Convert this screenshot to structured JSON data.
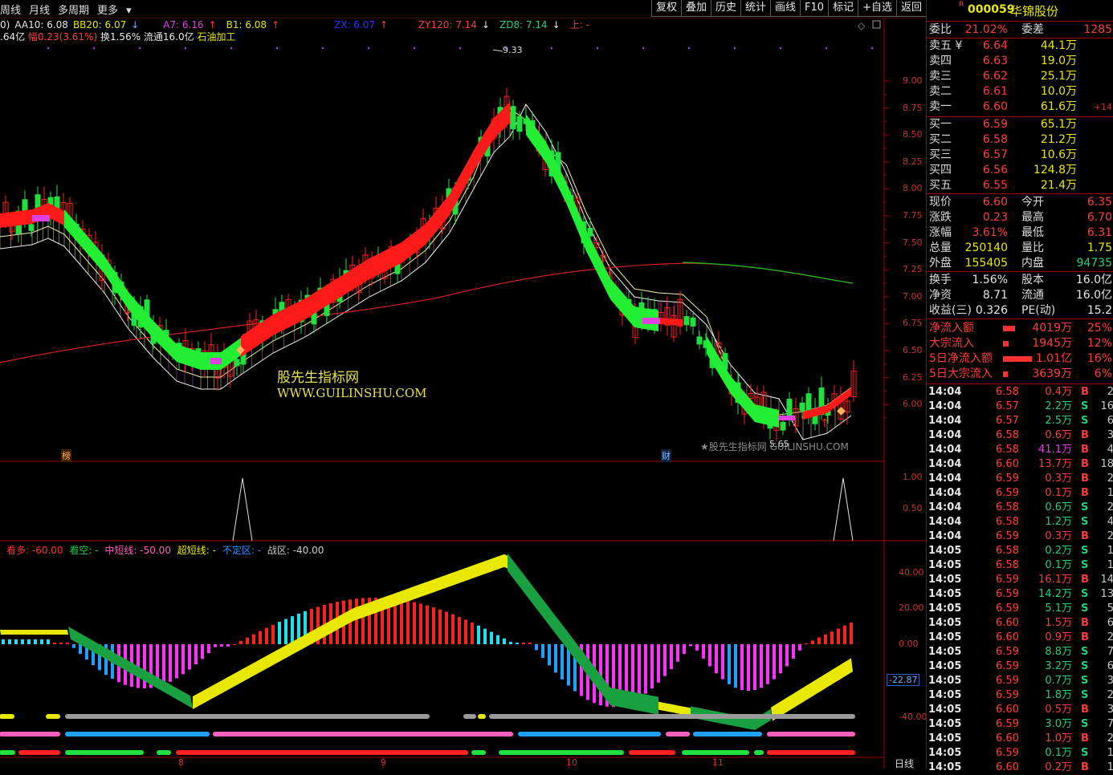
{
  "toolbar": {
    "left": [
      "周线",
      "月线",
      "多周期",
      "更多"
    ],
    "right": [
      "复权",
      "叠加",
      "历史",
      "统计",
      "画线",
      "F10",
      "标记",
      "+自选",
      "返回"
    ]
  },
  "indicators": {
    "p0": "0)",
    "aa10": "AA10: 6.08",
    "bb20": "BB20: 6.07",
    "a7": "A7: 6.16",
    "b1": "B1: 6.08",
    "zx": "ZX: 6.07",
    "zy120": "ZY120: 7.14",
    "zd8": "ZD8: 7.14",
    "up": "上: -"
  },
  "info": {
    "amount": ".64亿",
    "change": "幅0.23(3.61%)",
    "turnover": "换1.56%",
    "float": "流通16.0亿",
    "industry": "石油加工"
  },
  "price_axis": [
    "9.00",
    "8.75",
    "8.50",
    "8.25",
    "8.00",
    "7.75",
    "7.50",
    "7.25",
    "7.00",
    "6.75",
    "6.50",
    "6.25",
    "6.00"
  ],
  "mid_axis": [
    "1.00",
    "0.50"
  ],
  "low_axis": [
    "40.00",
    "20.00",
    "0.00",
    "-40.00"
  ],
  "low_axis_marker": "-22.87",
  "high_label": "9.33",
  "low_label": "5.65",
  "mark_bang": "榜",
  "mark_cai": "财",
  "watermark1": "股先生指标网",
  "watermark2": "WWW.GUILINSHU.COM",
  "watermark3": "★股先生指标网 GUILINSHU.COM",
  "lower_labels": {
    "l1": "看多: -60.00",
    "l2": "看空: -",
    "l3": "中短线: -50.00",
    "l4": "超短线: -",
    "l5": "不定区: -",
    "l6": "战区: -40.00"
  },
  "x_labels": [
    "8",
    "9",
    "10",
    "11"
  ],
  "period": "日线",
  "stock": {
    "flag": "R",
    "code": "000059",
    "name": "华锦股份"
  },
  "wb": {
    "label": "委比",
    "value": "21.02%",
    "label2": "委差",
    "value2": "1285"
  },
  "sell": [
    {
      "label": "卖五 ¥",
      "price": "6.64",
      "vol": "44.1万",
      "chg": ""
    },
    {
      "label": "卖四",
      "price": "6.63",
      "vol": "19.0万",
      "chg": ""
    },
    {
      "label": "卖三",
      "price": "6.62",
      "vol": "25.1万",
      "chg": ""
    },
    {
      "label": "卖二",
      "price": "6.61",
      "vol": "10.0万",
      "chg": ""
    },
    {
      "label": "卖一",
      "price": "6.60",
      "vol": "61.6万",
      "chg": "+14"
    }
  ],
  "buy": [
    {
      "label": "买一",
      "price": "6.59",
      "vol": "65.1万"
    },
    {
      "label": "买二",
      "price": "6.58",
      "vol": "21.2万"
    },
    {
      "label": "买三",
      "price": "6.57",
      "vol": "10.6万"
    },
    {
      "label": "买四",
      "price": "6.56",
      "vol": "124.8万"
    },
    {
      "label": "买五",
      "price": "6.55",
      "vol": "21.4万"
    }
  ],
  "quote": [
    {
      "l": "现价",
      "v": "6.60",
      "l2": "今开",
      "v2": "6.35"
    },
    {
      "l": "涨跌",
      "v": "0.23",
      "l2": "最高",
      "v2": "6.70"
    },
    {
      "l": "涨幅",
      "v": "3.61%",
      "l2": "最低",
      "v2": "6.31"
    },
    {
      "l": "总量",
      "v": "250140",
      "l2": "量比",
      "v2": "1.75"
    },
    {
      "l": "外盘",
      "v": "155405",
      "l2": "内盘",
      "v2": "94735"
    }
  ],
  "fund": [
    {
      "l": "换手",
      "v": "1.56%",
      "l2": "股本",
      "v2": "16.0亿"
    },
    {
      "l": "净资",
      "v": "8.71",
      "l2": "流通",
      "v2": "16.0亿"
    },
    {
      "l": "收益(三)",
      "v": "0.326",
      "l2": "PE(动)",
      "v2": "15.2"
    }
  ],
  "flow": [
    {
      "l": "净流入额",
      "v": "4019万",
      "p": "25%",
      "bar": 0.25
    },
    {
      "l": "大宗流入",
      "v": "1945万",
      "p": "12%",
      "bar": 0.12
    },
    {
      "l": "5日净流入额",
      "v": "1.01亿",
      "p": "16%",
      "bar": 0.6
    },
    {
      "l": "5日大宗流入",
      "v": "3639万",
      "p": "6%",
      "bar": 0.06
    }
  ],
  "ticks": [
    {
      "t": "14:04",
      "p": "6.58",
      "v": "0.4万",
      "s": "B",
      "n": "2"
    },
    {
      "t": "14:04",
      "p": "6.57",
      "v": "2.2万",
      "s": "S",
      "n": "16"
    },
    {
      "t": "14:04",
      "p": "6.57",
      "v": "2.5万",
      "s": "S",
      "n": "6"
    },
    {
      "t": "14:04",
      "p": "6.58",
      "v": "0.6万",
      "s": "B",
      "n": "3"
    },
    {
      "t": "14:04",
      "p": "6.58",
      "v": "41.1万",
      "s": "B",
      "n": "4"
    },
    {
      "t": "14:04",
      "p": "6.60",
      "v": "13.7万",
      "s": "B",
      "n": "18"
    },
    {
      "t": "14:04",
      "p": "6.59",
      "v": "0.3万",
      "s": "B",
      "n": "2"
    },
    {
      "t": "14:04",
      "p": "6.59",
      "v": "0.1万",
      "s": "B",
      "n": "1"
    },
    {
      "t": "14:04",
      "p": "6.58",
      "v": "0.6万",
      "s": "S",
      "n": "2"
    },
    {
      "t": "14:04",
      "p": "6.58",
      "v": "1.2万",
      "s": "S",
      "n": "4"
    },
    {
      "t": "14:04",
      "p": "6.59",
      "v": "0.3万",
      "s": "B",
      "n": "2"
    },
    {
      "t": "14:05",
      "p": "6.58",
      "v": "0.2万",
      "s": "S",
      "n": "1"
    },
    {
      "t": "14:05",
      "p": "6.58",
      "v": "0.1万",
      "s": "S",
      "n": "1"
    },
    {
      "t": "14:05",
      "p": "6.59",
      "v": "16.1万",
      "s": "B",
      "n": "14"
    },
    {
      "t": "14:05",
      "p": "6.59",
      "v": "14.2万",
      "s": "S",
      "n": "13"
    },
    {
      "t": "14:05",
      "p": "6.59",
      "v": "5.1万",
      "s": "S",
      "n": "5"
    },
    {
      "t": "14:05",
      "p": "6.60",
      "v": "1.5万",
      "s": "B",
      "n": "6"
    },
    {
      "t": "14:05",
      "p": "6.60",
      "v": "0.9万",
      "s": "B",
      "n": "2"
    },
    {
      "t": "14:05",
      "p": "6.59",
      "v": "8.8万",
      "s": "S",
      "n": "7"
    },
    {
      "t": "14:05",
      "p": "6.59",
      "v": "3.2万",
      "s": "S",
      "n": "6"
    },
    {
      "t": "14:05",
      "p": "6.59",
      "v": "0.7万",
      "s": "S",
      "n": "3"
    },
    {
      "t": "14:05",
      "p": "6.59",
      "v": "1.8万",
      "s": "S",
      "n": "2"
    },
    {
      "t": "14:05",
      "p": "6.60",
      "v": "0.5万",
      "s": "B",
      "n": "3"
    },
    {
      "t": "14:05",
      "p": "6.59",
      "v": "3.0万",
      "s": "S",
      "n": "7"
    },
    {
      "t": "14:05",
      "p": "6.60",
      "v": "1.0万",
      "s": "B",
      "n": "2"
    },
    {
      "t": "14:05",
      "p": "6.59",
      "v": "0.1万",
      "s": "S",
      "n": "1"
    },
    {
      "t": "14:05",
      "p": "6.60",
      "v": "0.2万",
      "s": "B",
      "n": "1"
    }
  ],
  "colors": {
    "up": "#ff2020",
    "down": "#20e040",
    "axis": "#a00000",
    "ribbon_up": "#ff1a1a",
    "ribbon_down": "#22ee33"
  }
}
